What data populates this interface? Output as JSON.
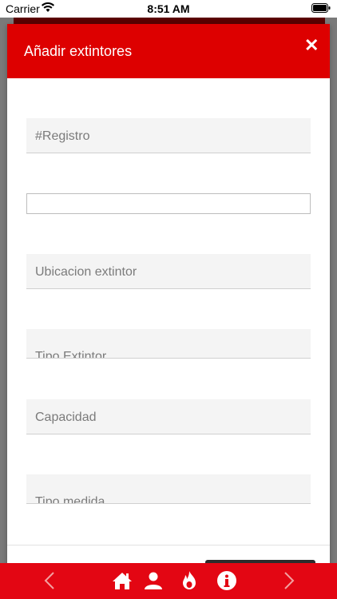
{
  "status_bar": {
    "carrier": "Carrier",
    "time": "8:51 AM"
  },
  "modal": {
    "title": "Añadir extintores",
    "close_icon": "close-icon",
    "fields": [
      {
        "placeholder": "#Registro"
      },
      {
        "placeholder": ""
      },
      {
        "placeholder": "Ubicacion extintor"
      },
      {
        "placeholder": "Tipo Extintor"
      },
      {
        "placeholder": "Capacidad"
      },
      {
        "placeholder": "Tipo medida"
      }
    ]
  },
  "bottom_nav": {
    "items": [
      "chevron-left-icon",
      "home-icon",
      "user-icon",
      "fire-icon",
      "info-icon",
      "chevron-right-icon"
    ]
  },
  "colors": {
    "header_red": "#dd0000",
    "nav_red": "#e30613"
  }
}
